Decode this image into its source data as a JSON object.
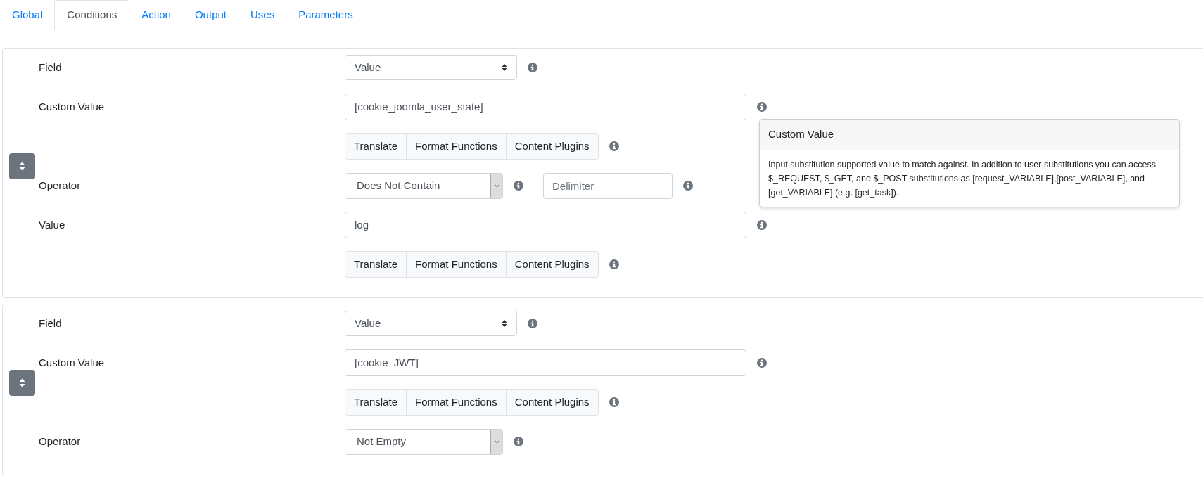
{
  "tabs": [
    {
      "label": "Global",
      "selected": false
    },
    {
      "label": "Conditions",
      "selected": true
    },
    {
      "label": "Action",
      "selected": false
    },
    {
      "label": "Output",
      "selected": false
    },
    {
      "label": "Uses",
      "selected": false
    },
    {
      "label": "Parameters",
      "selected": false
    }
  ],
  "conditions": [
    {
      "rows": [
        {
          "kind": "select",
          "label": "Field",
          "value": "Value"
        },
        {
          "kind": "input",
          "label": "Custom Value",
          "value": "[cookie_joomla_user_state]",
          "tooltip": {
            "title": "Custom Value",
            "text": "Input substitution supported value to match against. In addition to user substitutions you can access $_REQUEST, $_GET, and $_POST substitutions as [request_VARIABLE],[post_VARIABLE], and [get_VARIABLE] (e.g. [get_task])."
          }
        },
        {
          "kind": "buttons",
          "buttons": [
            "Translate",
            "Format Functions",
            "Content Plugins"
          ]
        },
        {
          "kind": "dropdown",
          "label": "Operator",
          "value": "Does Not Contain",
          "delimiter": {
            "placeholder": "Delimiter"
          }
        },
        {
          "kind": "input",
          "label": "Value",
          "value": "log"
        },
        {
          "kind": "buttons",
          "buttons": [
            "Translate",
            "Format Functions",
            "Content Plugins"
          ]
        }
      ]
    },
    {
      "rows": [
        {
          "kind": "select",
          "label": "Field",
          "value": "Value"
        },
        {
          "kind": "input",
          "label": "Custom Value",
          "value": "[cookie_JWT]"
        },
        {
          "kind": "buttons",
          "buttons": [
            "Translate",
            "Format Functions",
            "Content Plugins"
          ]
        },
        {
          "kind": "dropdown",
          "label": "Operator",
          "value": "Not Empty"
        }
      ]
    }
  ]
}
